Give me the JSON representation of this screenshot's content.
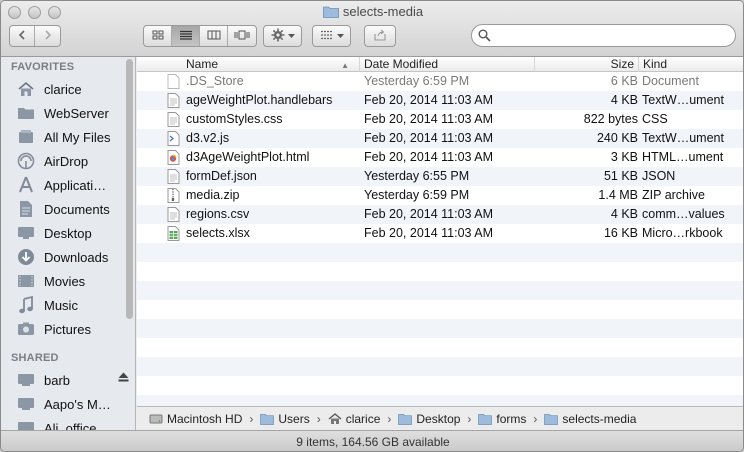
{
  "window": {
    "title": "selects-media"
  },
  "toolbar": {
    "nav_back_icon": "chevron-left",
    "nav_forward_icon": "chevron-right",
    "view_modes": [
      "icon-view",
      "list-view",
      "column-view",
      "cover-flow-view"
    ],
    "active_view": "list-view",
    "search": {
      "value": "",
      "placeholder": ""
    }
  },
  "sidebar": {
    "favorites_heading": "FAVORITES",
    "favorites": [
      {
        "label": "clarice",
        "icon": "home-icon"
      },
      {
        "label": "WebServer",
        "icon": "folder-icon"
      },
      {
        "label": "All My Files",
        "icon": "all-files-icon"
      },
      {
        "label": "AirDrop",
        "icon": "airdrop-icon"
      },
      {
        "label": "Applicati…",
        "icon": "applications-icon"
      },
      {
        "label": "Documents",
        "icon": "documents-icon"
      },
      {
        "label": "Desktop",
        "icon": "desktop-icon"
      },
      {
        "label": "Downloads",
        "icon": "downloads-icon"
      },
      {
        "label": "Movies",
        "icon": "movies-icon"
      },
      {
        "label": "Music",
        "icon": "music-icon"
      },
      {
        "label": "Pictures",
        "icon": "pictures-icon"
      }
    ],
    "shared_heading": "SHARED",
    "shared": [
      {
        "label": "barb",
        "icon": "computer-icon"
      },
      {
        "label": "Aapo's M…",
        "icon": "computer-icon"
      },
      {
        "label": "Ali_office",
        "icon": "computer-icon"
      }
    ]
  },
  "columns": {
    "name": "Name",
    "date": "Date Modified",
    "size": "Size",
    "kind": "Kind"
  },
  "files": [
    {
      "name": ".DS_Store",
      "date": "Yesterday 6:59 PM",
      "size": "6 KB",
      "kind": "Document",
      "icon": "blank-doc-icon",
      "dim": true
    },
    {
      "name": "ageWeightPlot.handlebars",
      "date": "Feb 20, 2014 11:03 AM",
      "size": "4 KB",
      "kind": "TextW…ument",
      "icon": "text-doc-icon"
    },
    {
      "name": "customStyles.css",
      "date": "Feb 20, 2014 11:03 AM",
      "size": "822 bytes",
      "kind": "CSS",
      "icon": "text-doc-icon"
    },
    {
      "name": "d3.v2.js",
      "date": "Feb 20, 2014 11:03 AM",
      "size": "240 KB",
      "kind": "TextW…ument",
      "icon": "script-doc-icon"
    },
    {
      "name": "d3AgeWeightPlot.html",
      "date": "Feb 20, 2014 11:03 AM",
      "size": "3 KB",
      "kind": "HTML…ument",
      "icon": "html-doc-icon"
    },
    {
      "name": "formDef.json",
      "date": "Yesterday 6:55 PM",
      "size": "51 KB",
      "kind": "JSON",
      "icon": "text-doc-icon"
    },
    {
      "name": "media.zip",
      "date": "Yesterday 6:59 PM",
      "size": "1.4 MB",
      "kind": "ZIP archive",
      "icon": "zip-icon"
    },
    {
      "name": "regions.csv",
      "date": "Feb 20, 2014 11:03 AM",
      "size": "4 KB",
      "kind": "comm…values",
      "icon": "text-doc-icon"
    },
    {
      "name": "selects.xlsx",
      "date": "Feb 20, 2014 11:03 AM",
      "size": "16 KB",
      "kind": "Micro…rkbook",
      "icon": "spreadsheet-icon"
    }
  ],
  "path": [
    {
      "label": "Macintosh HD",
      "icon": "hard-drive-icon"
    },
    {
      "label": "Users",
      "icon": "folder-icon"
    },
    {
      "label": "clarice",
      "icon": "home-icon"
    },
    {
      "label": "Desktop",
      "icon": "folder-icon"
    },
    {
      "label": "forms",
      "icon": "folder-icon"
    },
    {
      "label": "selects-media",
      "icon": "folder-icon"
    }
  ],
  "status": "9 items, 164.56 GB available",
  "colors": {
    "row_alt": "#f1f5fa",
    "sidebar_bg": "#e6e9ee",
    "folder_blue": "#8fb3d9"
  }
}
